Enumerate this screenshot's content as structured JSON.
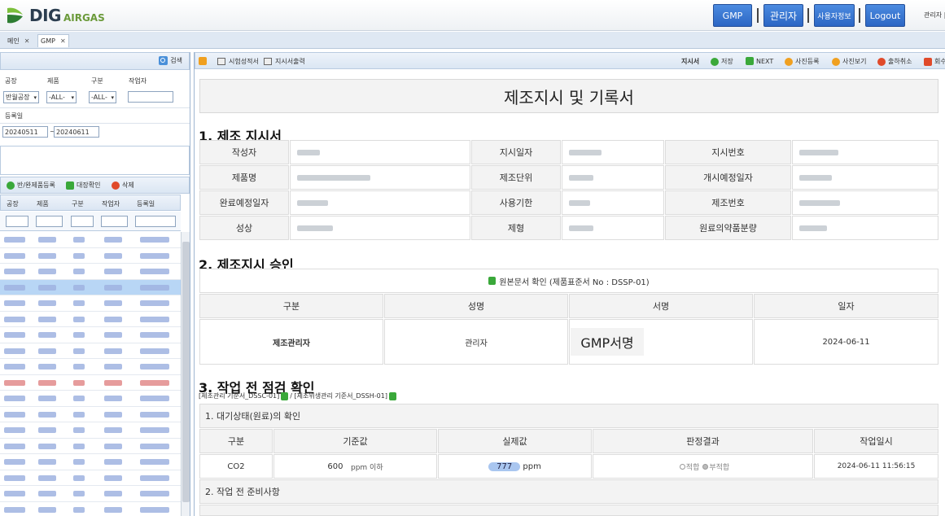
{
  "header": {
    "logo_text": "DIG",
    "logo_sub": "AIRGAS",
    "buttons": {
      "gmp": "GMP",
      "admin": "관리자",
      "userinfo": "사용자정보",
      "logout": "Logout"
    },
    "user_label": "관리자 |"
  },
  "tabs": [
    {
      "label": "메인"
    },
    {
      "label": "GMP"
    }
  ],
  "left": {
    "search_label": "검색",
    "filters": {
      "factory_label": "공장",
      "factory_value": "반월공장",
      "product_label": "제품",
      "product_value": "-ALL-",
      "type_label": "구분",
      "type_value": "-ALL-",
      "worker_label": "작업자",
      "reg_date_label": "등록일",
      "date_from": "20240511",
      "date_sep": "~",
      "date_to": "20240611"
    },
    "tools": {
      "register": "반/완제품등록",
      "target_check": "대장확인",
      "delete": "삭제"
    },
    "columns": [
      "공장",
      "제품",
      "구분",
      "작업자",
      "등록일"
    ]
  },
  "right": {
    "tools": {
      "test_report": "시험성적서",
      "order_print": "지시서출력",
      "order_label": "지시서",
      "save": "저장",
      "next": "NEXT",
      "photo_register": "사진등록",
      "photo_view": "사진보기",
      "cancel_request": "출하취소",
      "recall": "회수"
    },
    "doc_title": "제조지시 및 기록서",
    "section1": {
      "title": "1. 제조 지시서",
      "labels": [
        "작성자",
        "지시일자",
        "지시번호",
        "제품명",
        "제조단위",
        "개시예정일자",
        "완료예정일자",
        "사용기한",
        "제조번호",
        "성상",
        "제형",
        "원료의약품분량"
      ]
    },
    "section2": {
      "title": "2. 제조지시 승인",
      "doc_check": "원본문서 확인 (제품표준서 No : DSSP-01)",
      "headers": [
        "구분",
        "성명",
        "서명",
        "일자"
      ],
      "row": {
        "role": "제조관리자",
        "name": "관리자",
        "sign": "GMP서명",
        "date": "2024-06-11"
      }
    },
    "section3": {
      "title": "3. 작업 전 점검 확인",
      "std_link1": "[제조관리 기준서_DSSC-01]",
      "std_sep": "/",
      "std_link2": "[제조위생관리 기준서_DSSH-01]",
      "sub1": "1. 대기상태(원료)의 확인",
      "headers": [
        "구분",
        "기준값",
        "실제값",
        "판정결과",
        "작업일시"
      ],
      "row": {
        "type": "CO2",
        "std_value": "600",
        "std_unit": "ppm 이하",
        "actual": "777",
        "actual_unit": "ppm",
        "pass": "적합",
        "fail": "부적합",
        "datetime": "2024-06-11 11:56:15"
      },
      "sub2": "2. 작업 전 준비사항"
    }
  }
}
